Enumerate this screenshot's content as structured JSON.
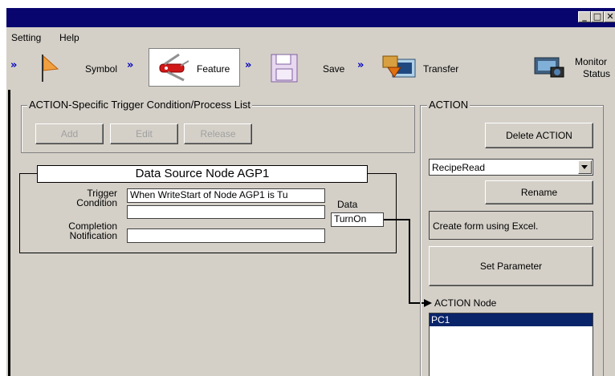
{
  "window": {
    "controls": {
      "minimize": "_",
      "maximize": "□",
      "close": "✕"
    }
  },
  "menu": {
    "items": [
      "Setting",
      "Help"
    ]
  },
  "toolbar": {
    "steps": [
      {
        "label": "Symbol",
        "icon": "flag-icon"
      },
      {
        "label": "Feature",
        "icon": "knife-icon"
      },
      {
        "label": "Save",
        "icon": "floppy-disk-icon"
      },
      {
        "label": "Transfer",
        "icon": "transfer-icon"
      }
    ],
    "chevron": "»",
    "monitor": {
      "line1": "Monitor",
      "line2": "Status",
      "icon": "monitor-camera-icon"
    }
  },
  "trigger_list": {
    "title": "ACTION-Specific Trigger Condition/Process List",
    "buttons": {
      "add": "Add",
      "edit": "Edit",
      "release": "Release"
    }
  },
  "source_node": {
    "title": "Data Source Node AGP1",
    "trigger_label_1": "Trigger",
    "trigger_label_2": "Condition",
    "trigger_value": "When WriteStart of Node AGP1 is Tu",
    "completion_label_1": "Completion",
    "completion_label_2": "Notification",
    "completion_value": "",
    "data_label": "Data",
    "data_value": "TurnOn"
  },
  "action": {
    "title": "ACTION",
    "delete_label": "Delete ACTION",
    "selected_action": "RecipeRead",
    "rename_label": "Rename",
    "excel_label": "Create form using Excel.",
    "set_parameter_label": "Set Parameter",
    "node_label": "ACTION Node",
    "nodes": [
      "PC1"
    ]
  },
  "colors": {
    "title_bar": "#08066e",
    "face": "#d4d0c8",
    "selection": "#0a246a",
    "chevron": "#0000c0"
  }
}
